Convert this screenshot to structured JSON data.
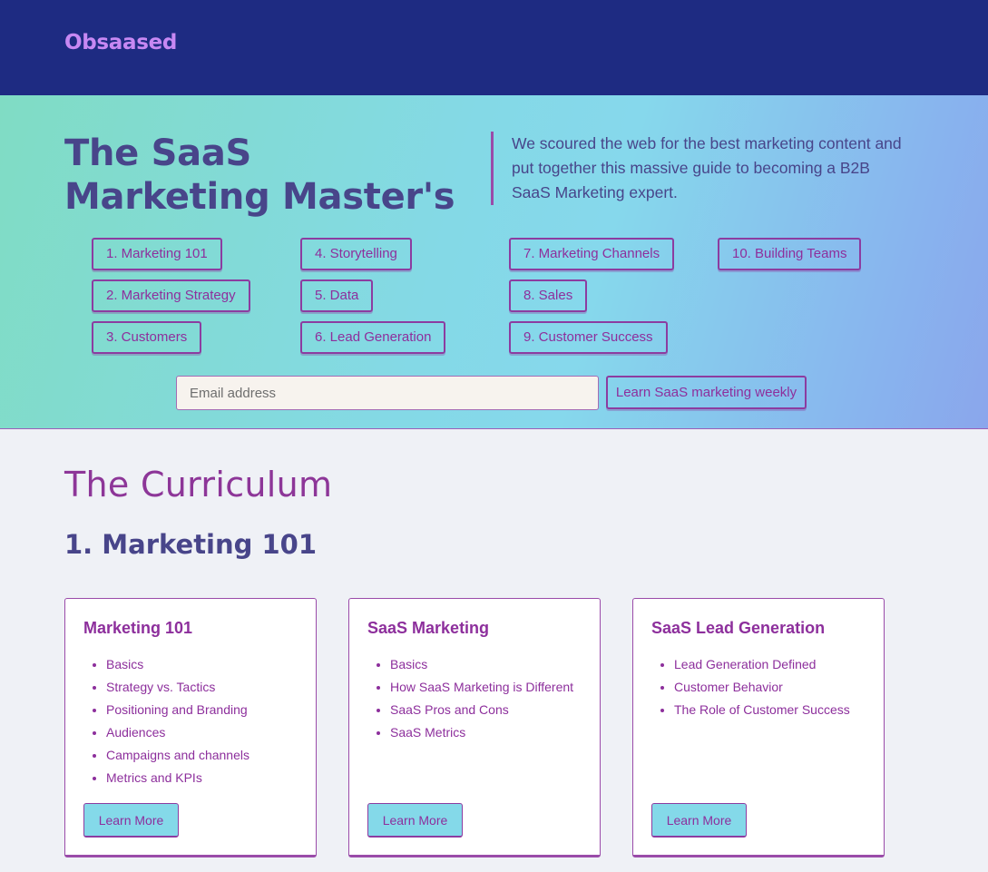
{
  "header": {
    "brand": "Obsaased"
  },
  "hero": {
    "title": "The SaaS Marketing Master's",
    "description": "We scoured the web for the best marketing content and put together this massive guide to becoming a B2B SaaS Marketing expert.",
    "chapters": [
      "1. Marketing 101",
      "2. Marketing Strategy",
      "3. Customers",
      "4. Storytelling",
      "5. Data",
      "6. Lead Generation",
      "7. Marketing Channels",
      "8. Sales",
      "9. Customer Success",
      "10. Building Teams"
    ],
    "email_placeholder": "Email address",
    "subscribe_label": "Learn SaaS marketing weekly"
  },
  "curriculum": {
    "heading": "The Curriculum",
    "section_title": "1. Marketing 101",
    "cards": [
      {
        "title": "Marketing 101",
        "items": [
          "Basics",
          "Strategy vs. Tactics",
          "Positioning and Branding",
          "Audiences",
          "Campaigns and channels",
          "Metrics and KPIs"
        ],
        "button": "Learn More"
      },
      {
        "title": "SaaS Marketing",
        "items": [
          "Basics",
          "How SaaS Marketing is Different",
          "SaaS Pros and Cons",
          "SaaS Metrics"
        ],
        "button": "Learn More"
      },
      {
        "title": "SaaS Lead Generation",
        "items": [
          "Lead Generation Defined",
          "Customer Behavior",
          "The Role of Customer Success"
        ],
        "button": "Learn More"
      }
    ]
  }
}
